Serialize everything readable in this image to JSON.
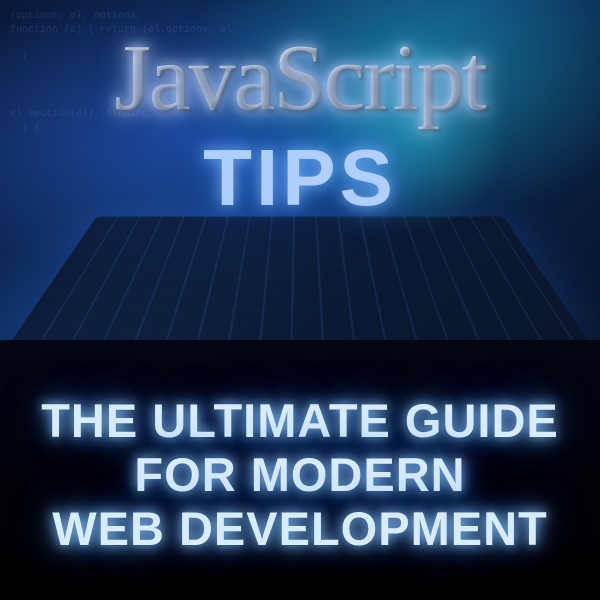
{
  "title": {
    "main": "JavaScript",
    "accent": "TIPS"
  },
  "subtitle": {
    "line1": "THE ULTIMATE GUIDE",
    "line2": "FOR MODERN",
    "line3": "WEB DEVELOPMENT"
  },
  "colors": {
    "glow_blue": "#8ccfff",
    "dark_bg": "#020612",
    "teal_glow": "#32c8dc"
  }
}
